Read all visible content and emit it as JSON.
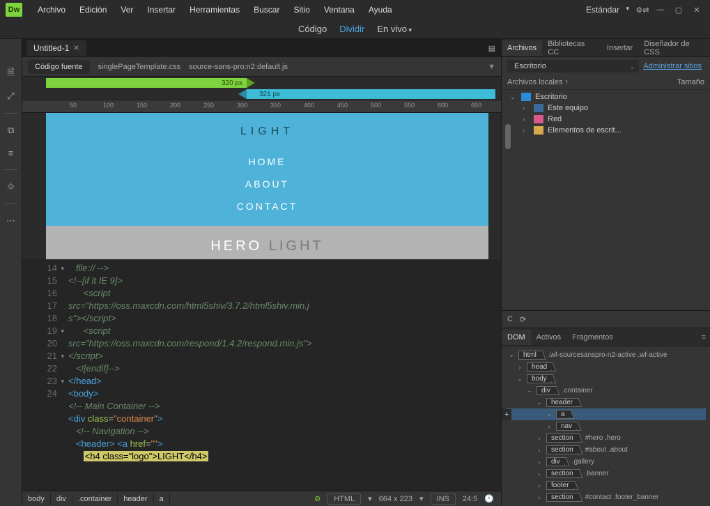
{
  "app": {
    "logo": "Dw"
  },
  "menubar": {
    "items": [
      "Archivo",
      "Edición",
      "Ver",
      "Insertar",
      "Herramientas",
      "Buscar",
      "Sitio",
      "Ventana",
      "Ayuda"
    ],
    "workspace": "Estándar"
  },
  "view_switcher": {
    "code": "Código",
    "split": "Dividir",
    "live": "En vivo"
  },
  "document": {
    "tab": "Untitled-1",
    "source_btn": "Código fuente",
    "related": [
      "singlePageTemplate.css",
      "source-sans-pro:n2:default.js"
    ]
  },
  "mq": {
    "bar1": "320  px",
    "bar2": "321  px"
  },
  "ruler": {
    "ticks": [
      50,
      100,
      150,
      200,
      250,
      300,
      350,
      400,
      450,
      500,
      550,
      600,
      650
    ]
  },
  "preview": {
    "logo": "LIGHT",
    "nav": [
      "HOME",
      "ABOUT",
      "CONTACT"
    ],
    "hero_a": "HERO",
    "hero_b": "LIGHT"
  },
  "code": {
    "gutter": [
      {
        "n": "",
        "fold": false
      },
      {
        "n": "14",
        "fold": true
      },
      {
        "n": "15",
        "fold": false
      },
      {
        "n": "",
        "fold": false
      },
      {
        "n": "",
        "fold": false
      },
      {
        "n": "16",
        "fold": false
      },
      {
        "n": "",
        "fold": false
      },
      {
        "n": "",
        "fold": false
      },
      {
        "n": "17",
        "fold": false
      },
      {
        "n": "18",
        "fold": false
      },
      {
        "n": "19",
        "fold": true
      },
      {
        "n": "20",
        "fold": false
      },
      {
        "n": "21",
        "fold": true
      },
      {
        "n": "22",
        "fold": false
      },
      {
        "n": "23",
        "fold": true
      },
      {
        "n": "24",
        "fold": false
      }
    ],
    "line0": "   file:// -->",
    "line1a": "<!--[if lt IE 9]>",
    "line2a": "      <script",
    "line2b": "src=\"https://oss.maxcdn.com/html5shiv/3.7.2/html5shiv.min.j",
    "line2c": "s\"></script>",
    "line3a": "      <script",
    "line3b": "src=\"https://oss.maxcdn.com/respond/1.4.2/respond.min.js\">",
    "line3c": "</script>",
    "line4": "   <![endif]-->",
    "line5o": "</",
    "line5t": "head",
    "line5c": ">",
    "line6o": "<",
    "line6t": "body",
    "line6c": ">",
    "line7": "<!-- Main Container -->",
    "line8o": "<",
    "line8t": "div",
    "line8a": " class",
    "line8e": "=",
    "line8v": "\"container\"",
    "line8c": ">",
    "line9": "   <!-- Navigation -->",
    "line10o": "   <",
    "line10t": "header",
    "line10c": "> <",
    "line10t2": "a",
    "line10a": " href",
    "line10e": "=",
    "line10v": "\"\"",
    "line10c2": ">",
    "line11pre": "      ",
    "line11hl": "<h4 class=\"logo\">LIGHT</h4>"
  },
  "status": {
    "crumbs": [
      "body",
      "div",
      ".container",
      "header",
      "a"
    ],
    "lang": "HTML",
    "dims": "664 x 223",
    "ins": "INS",
    "line": "24:5"
  },
  "files_panel": {
    "tabs": [
      "Archivos",
      "Bibliotecas CC",
      "Insertar",
      "Diseñador de CSS"
    ],
    "site": "Escritorio",
    "manage": "Administrar sitios",
    "col1": "Archivos locales ↑",
    "col2": "Tamaño",
    "tree": [
      {
        "tw": "⌄",
        "icon": "desktop",
        "label": "Escritorio",
        "indent": 0,
        "sel": true
      },
      {
        "tw": "›",
        "icon": "pc",
        "label": "Este equipo",
        "indent": 1
      },
      {
        "tw": "›",
        "icon": "net",
        "label": "Red",
        "indent": 1
      },
      {
        "tw": "›",
        "icon": "folder",
        "label": "Elementos de escrit...",
        "indent": 1
      }
    ]
  },
  "dom_panel": {
    "tabs": [
      "DOM",
      "Activos",
      "Fragmentos"
    ],
    "rows": [
      {
        "tw": "⌄",
        "tag": "html",
        "cls": ".wf-sourcesanspro-n2-active .wf-active",
        "i": 0
      },
      {
        "tw": "›",
        "tag": "head",
        "cls": "",
        "i": 1
      },
      {
        "tw": "⌄",
        "tag": "body",
        "cls": "",
        "i": 1
      },
      {
        "tw": "⌄",
        "tag": "div",
        "cls": ".container",
        "i": 2
      },
      {
        "tw": "⌄",
        "tag": "header",
        "cls": "",
        "i": 3
      },
      {
        "tw": "›",
        "tag": "a",
        "cls": "",
        "i": 4,
        "sel": true
      },
      {
        "tw": "›",
        "tag": "nav",
        "cls": "",
        "i": 4
      },
      {
        "tw": "›",
        "tag": "section",
        "cls": "#hero .hero",
        "i": 3
      },
      {
        "tw": "›",
        "tag": "section",
        "cls": "#about .about",
        "i": 3
      },
      {
        "tw": "›",
        "tag": "div",
        "cls": ".gallery",
        "i": 3
      },
      {
        "tw": "›",
        "tag": "section",
        "cls": ".banner",
        "i": 3
      },
      {
        "tw": "›",
        "tag": "footer",
        "cls": "",
        "i": 3
      },
      {
        "tw": "›",
        "tag": "section",
        "cls": "#contact .footer_banner",
        "i": 3
      }
    ],
    "add": "+"
  }
}
